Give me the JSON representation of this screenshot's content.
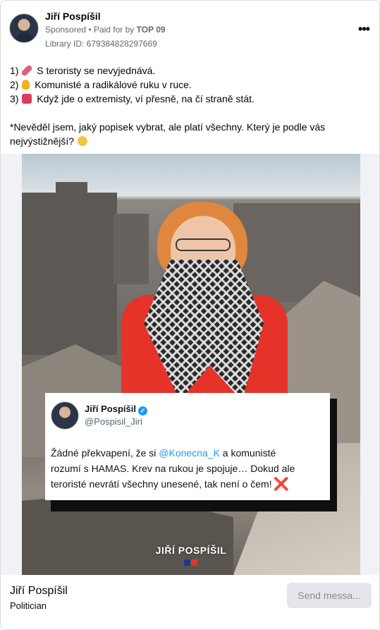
{
  "post": {
    "author": "Jiří Pospíšil",
    "sponsored_label": "Sponsored",
    "separator": "•",
    "paid_prefix": "Paid for by",
    "payer": "TOP 09",
    "library_id": "Library ID: 679384828297669",
    "more_icon": "more-horizontal-icon",
    "body_lines": [
      {
        "num": "1)",
        "emoji": "syringe-emoji",
        "text": "S teroristy se nevyjednává."
      },
      {
        "num": "2)",
        "emoji": "thumbs-down-emoji",
        "text": "Komunisté a radikálové ruku v ruce."
      },
      {
        "num": "3)",
        "emoji": "red-square-emoji",
        "text": "Když jde o extremisty, ví přesně, na čí straně stát."
      }
    ],
    "caption_line1": "*Nevěděl jsem, jaký popisek vybrat, ale platí všechny. Který je podle vás",
    "caption_line2": "nejvýstižnější?",
    "caption_emoji": "thinking-face-emoji"
  },
  "media": {
    "tweet": {
      "name": "Jiří Pospíšil",
      "verified_icon": "verified-badge-icon",
      "handle": "@Pospisil_Jiri",
      "line1_before": "Žádné překvapení, že si ",
      "mention": "@Konecna_K",
      "line1_after": " a komunisté",
      "line2": "rozumí s HAMAS. Krev na rukou je spojuje… Dokud ale",
      "line3": "teroristé nevrátí všechny unesené, tak není o čem!",
      "x_emoji": "❌"
    },
    "brand_text": "JIŘÍ POSPÍŠIL",
    "brand_colors": [
      "#1d3a8a",
      "#e6332a"
    ]
  },
  "footer": {
    "page_name": "Jiří Pospíšil",
    "category": "Politician",
    "button_label": "Send messa..."
  }
}
